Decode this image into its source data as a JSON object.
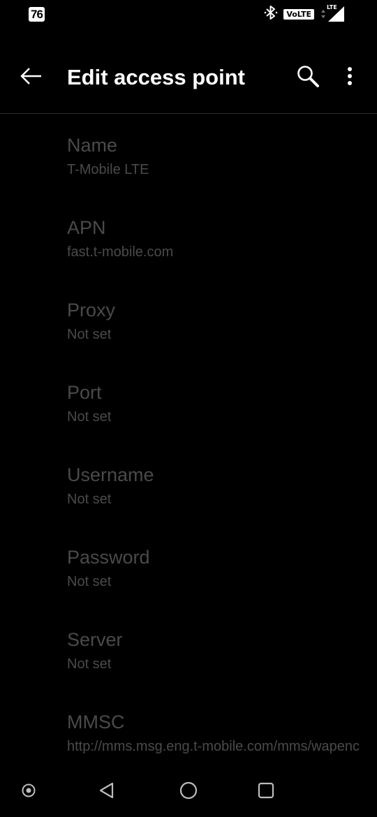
{
  "status_bar": {
    "battery_level": "76",
    "volte_label": "VoLTE",
    "network_label": "LTE"
  },
  "app_bar": {
    "title": "Edit access point"
  },
  "preferences": [
    {
      "title": "Name",
      "summary": "T-Mobile LTE"
    },
    {
      "title": "APN",
      "summary": "fast.t-mobile.com"
    },
    {
      "title": "Proxy",
      "summary": "Not set"
    },
    {
      "title": "Port",
      "summary": "Not set"
    },
    {
      "title": "Username",
      "summary": "Not set"
    },
    {
      "title": "Password",
      "summary": "Not set"
    },
    {
      "title": "Server",
      "summary": "Not set"
    },
    {
      "title": "MMSC",
      "summary": "http://mms.msg.eng.t-mobile.com/mms/wapenc"
    }
  ],
  "icons": {
    "back": "arrow-back-icon",
    "search": "search-icon",
    "more": "more-vert-icon",
    "bluetooth": "bluetooth-icon",
    "signal": "signal-icon",
    "nav_assist": "assistant-dot-icon",
    "nav_back": "nav-back-icon",
    "nav_home": "nav-home-icon",
    "nav_recents": "nav-recents-icon"
  },
  "colors": {
    "background": "#000000",
    "title_text": "#ffffff",
    "disabled_text": "#4a4a4a",
    "divider": "#2a2a2a",
    "nav_icon": "#bdbdbd"
  }
}
